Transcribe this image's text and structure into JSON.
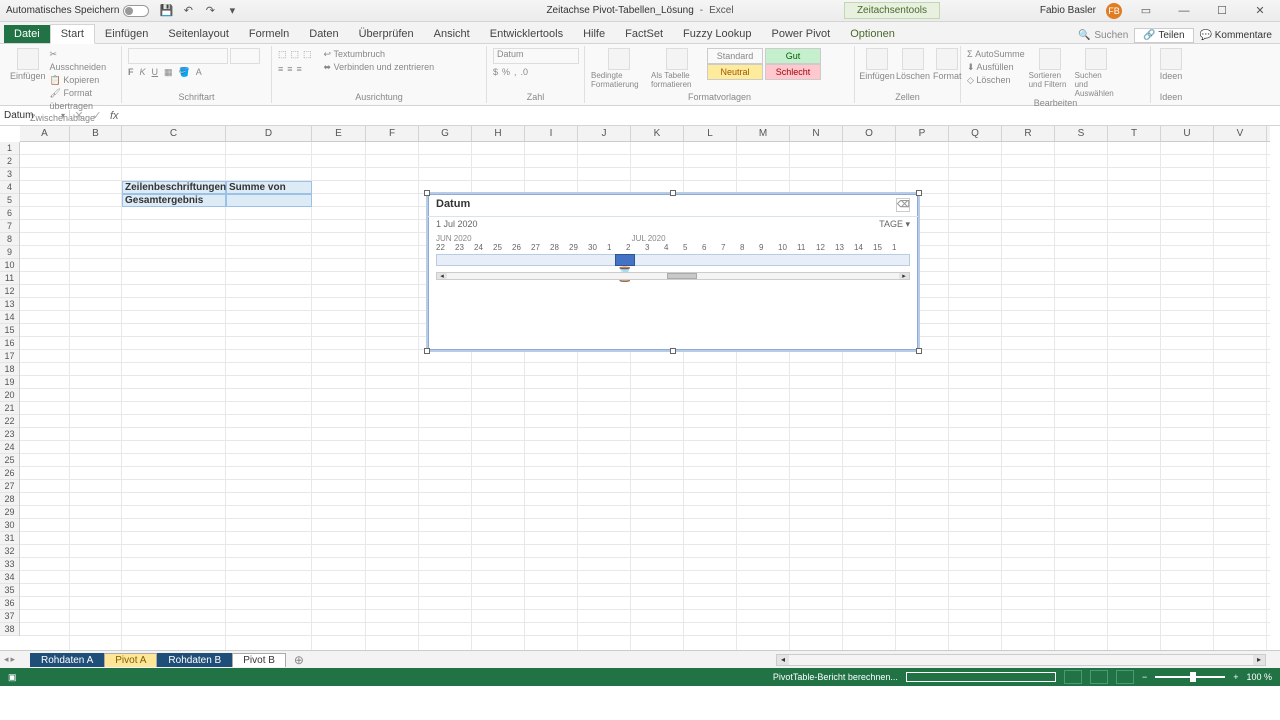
{
  "titlebar": {
    "autosave_label": "Automatisches Speichern",
    "filename": "Zeitachse Pivot-Tabellen_Lösung",
    "app": "Excel",
    "contextual_tab": "Zeitachsentools",
    "user": "Fabio Basler",
    "user_initials": "FB"
  },
  "tabs": {
    "file": "Datei",
    "items": [
      "Start",
      "Einfügen",
      "Seitenlayout",
      "Formeln",
      "Daten",
      "Überprüfen",
      "Ansicht",
      "Entwicklertools",
      "Hilfe",
      "FactSet",
      "Fuzzy Lookup",
      "Power Pivot",
      "Optionen"
    ],
    "active": "Start",
    "context": "Optionen",
    "search_placeholder": "Suchen",
    "share": "Teilen",
    "comments": "Kommentare"
  },
  "ribbon": {
    "clipboard": {
      "paste": "Einfügen",
      "cut": "Ausschneiden",
      "copy": "Kopieren",
      "format": "Format übertragen",
      "label": "Zwischenablage"
    },
    "font": {
      "label": "Schriftart"
    },
    "align": {
      "wrap": "Textumbruch",
      "merge": "Verbinden und zentrieren",
      "label": "Ausrichtung"
    },
    "number": {
      "fmt": "Datum",
      "label": "Zahl"
    },
    "cond": {
      "cond": "Bedingte Formatierung",
      "astable": "Als Tabelle formatieren"
    },
    "styles": {
      "standard": "Standard",
      "gut": "Gut",
      "neutral": "Neutral",
      "schlecht": "Schlecht",
      "label": "Formatvorlagen"
    },
    "cells": {
      "insert": "Einfügen",
      "delete": "Löschen",
      "format": "Format",
      "label": "Zellen"
    },
    "editing": {
      "autosum": "AutoSumme",
      "fill": "Ausfüllen",
      "clear": "Löschen",
      "sort": "Sortieren und Filtern",
      "find": "Suchen und Auswählen",
      "label": "Bearbeiten"
    },
    "ideas": {
      "ideas": "Ideen",
      "label": "Ideen"
    }
  },
  "namebox": "Datum",
  "columns": [
    "A",
    "B",
    "C",
    "D",
    "E",
    "F",
    "G",
    "H",
    "I",
    "J",
    "K",
    "L",
    "M",
    "N",
    "O",
    "P",
    "Q",
    "R",
    "S",
    "T",
    "U",
    "V"
  ],
  "pivot": {
    "rowlabels": "Zeilenbeschriftungen",
    "sumof": "Summe von Umsatz",
    "grand": "Gesamtergebnis"
  },
  "slicer": {
    "title": "Datum",
    "selected": "1 Jul 2020",
    "level": "TAGE",
    "month1": "JUN 2020",
    "month2": "JUL 2020",
    "days": [
      "22",
      "23",
      "24",
      "25",
      "26",
      "27",
      "28",
      "29",
      "30",
      "1",
      "2",
      "3",
      "4",
      "5",
      "6",
      "7",
      "8",
      "9",
      "10",
      "11",
      "12",
      "13",
      "14",
      "15",
      "1"
    ]
  },
  "sheets": [
    "Rohdaten A",
    "Pivot A",
    "Rohdaten B",
    "Pivot B"
  ],
  "status": {
    "msg": "PivotTable-Bericht berechnen...",
    "zoom": "100 %"
  }
}
